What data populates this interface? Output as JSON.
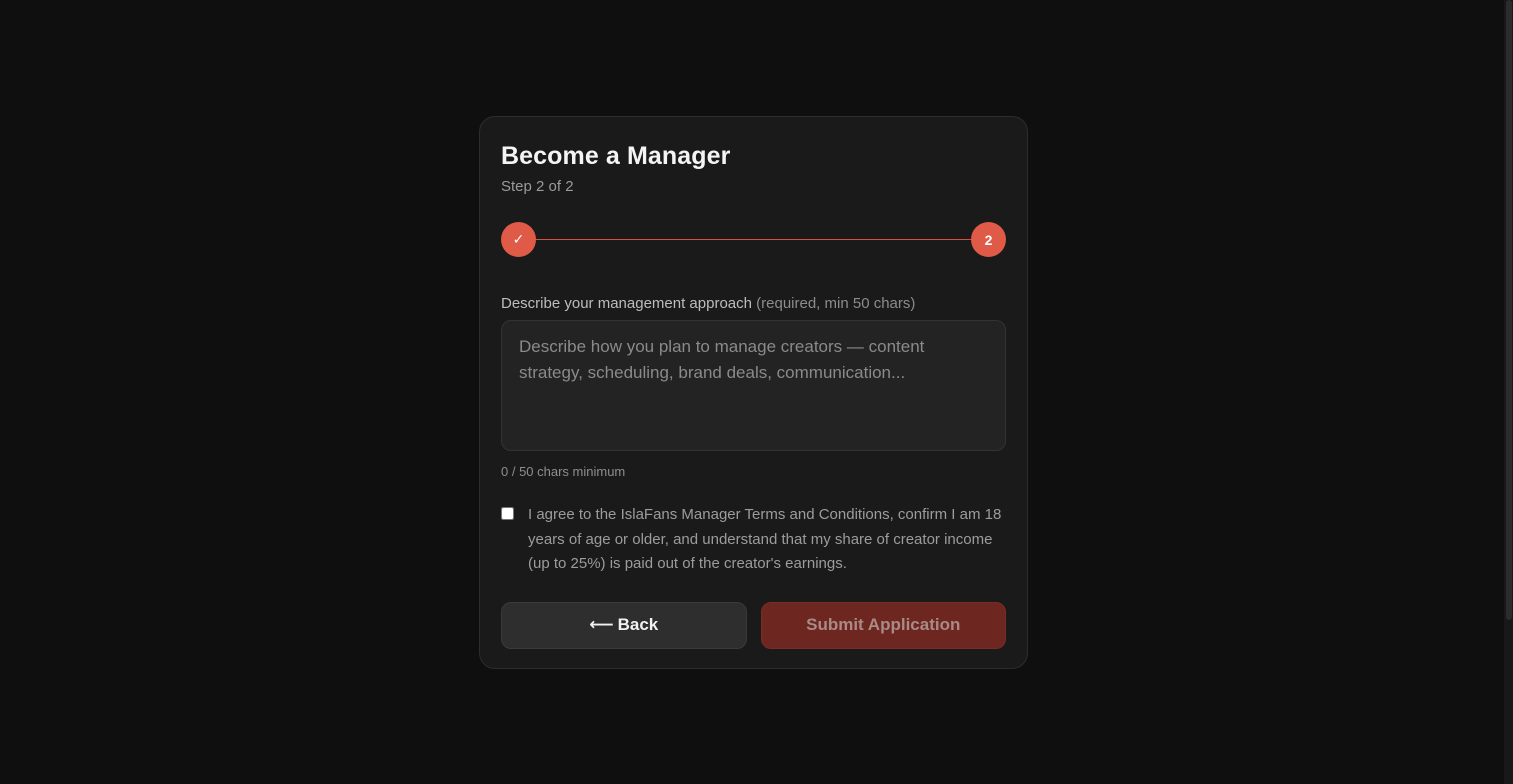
{
  "card": {
    "title": "Become a Manager",
    "subtitle": "Step 2 of 2"
  },
  "stepper": {
    "step1": "✓",
    "step2": "2",
    "accent_color": "#e05a48"
  },
  "approach": {
    "label": "Describe your management approach",
    "hint": "(required, min 50 chars)",
    "value": "",
    "placeholder": "Describe how you plan to manage creators — content strategy, scheduling, brand deals, communication...",
    "char_count": "0 / 50 chars minimum"
  },
  "terms": {
    "checked": false,
    "text": "I agree to the IslaFans Manager Terms and Conditions, confirm I am 18 years of age or older, and understand that my share of creator income (up to 25%) is paid out of the creator's earnings."
  },
  "actions": {
    "back_arrow": "⟵",
    "back_label": "Back",
    "submit_label": "Submit Application"
  }
}
